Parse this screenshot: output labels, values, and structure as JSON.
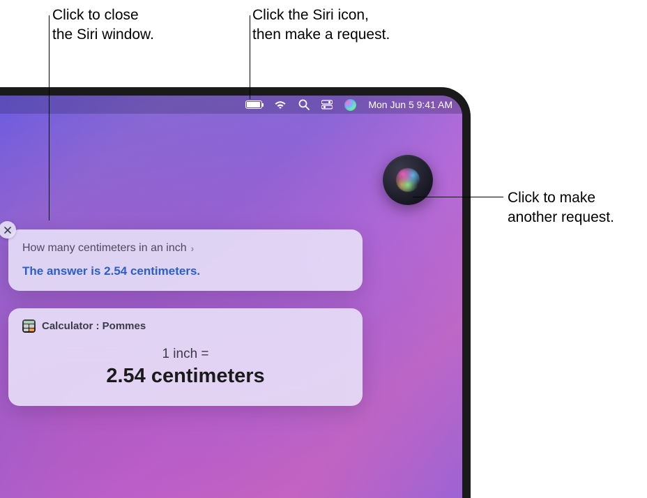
{
  "callouts": {
    "close": "Click to close\nthe Siri window.",
    "siri_menu": "Click the Siri icon,\nthen make a request.",
    "siri_orb": "Click to make\nanother request."
  },
  "menubar": {
    "datetime": "Mon Jun 5  9:41 AM"
  },
  "siri": {
    "query": "How many centimeters in an inch",
    "answer": "The answer is 2.54 centimeters."
  },
  "calculator": {
    "title": "Calculator : Pommes",
    "equation": "1 inch =",
    "result": "2.54 centimeters"
  }
}
